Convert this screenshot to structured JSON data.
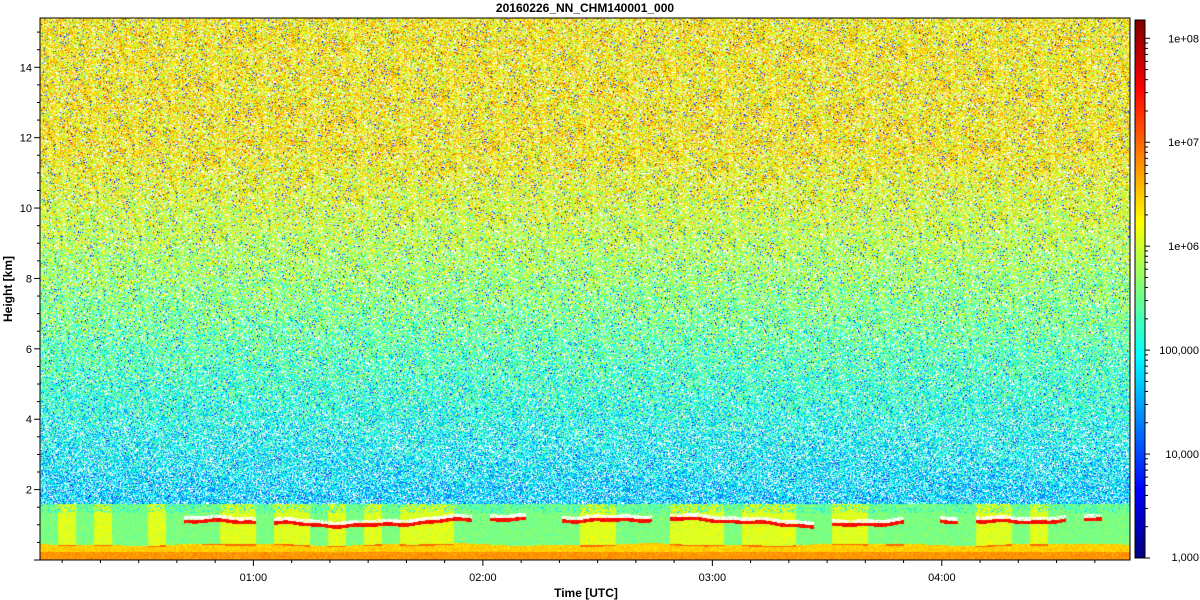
{
  "chart_data": {
    "type": "heatmap",
    "title": "20160226_NN_CHM140001_000",
    "xlabel": "Time [UTC]",
    "ylabel": "Height [km]",
    "x_range_utc_hours": [
      0.07,
      4.82
    ],
    "xlim": [
      0.07,
      4.82
    ],
    "ylim": [
      0,
      15.4
    ],
    "x_ticks": [
      {
        "value": 1,
        "label": "01:00"
      },
      {
        "value": 2,
        "label": "02:00"
      },
      {
        "value": 3,
        "label": "03:00"
      },
      {
        "value": 4,
        "label": "04:00"
      }
    ],
    "y_ticks": [
      {
        "value": 2,
        "label": "2"
      },
      {
        "value": 4,
        "label": "4"
      },
      {
        "value": 6,
        "label": "6"
      },
      {
        "value": 8,
        "label": "8"
      },
      {
        "value": 10,
        "label": "10"
      },
      {
        "value": 12,
        "label": "12"
      },
      {
        "value": 14,
        "label": "14"
      }
    ],
    "colorbar": {
      "scale": "log",
      "range": [
        1000,
        150000000
      ],
      "ticks": [
        {
          "value": 1000,
          "label": "1,000"
        },
        {
          "value": 10000,
          "label": "10,000"
        },
        {
          "value": 100000,
          "label": "100,000"
        },
        {
          "value": 1000000,
          "label": "1e+06"
        },
        {
          "value": 10000000,
          "label": "1e+07"
        },
        {
          "value": 100000000,
          "label": "1e+08"
        }
      ],
      "colors": [
        "#00007f",
        "#0000ff",
        "#007fff",
        "#00ffff",
        "#7fff7f",
        "#ffff00",
        "#ff7f00",
        "#ff0000",
        "#7f0000"
      ]
    },
    "features": {
      "surface_layer_top_km": 0.5,
      "boundary_layer_top_km": [
        1.1,
        1.4
      ],
      "noise_background": "log10 ~5-6.5 increasing with height"
    }
  }
}
